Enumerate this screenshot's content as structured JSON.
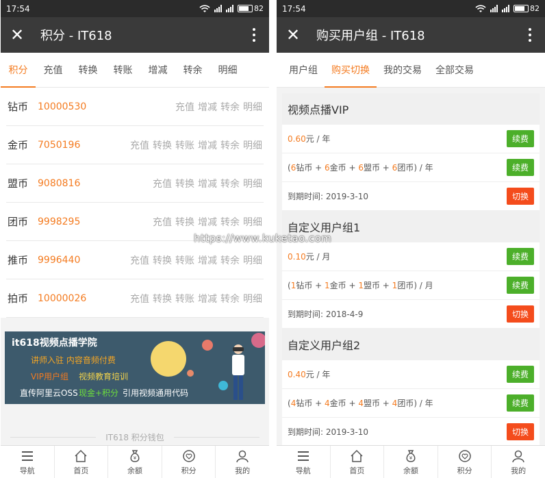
{
  "status": {
    "time": "17:54",
    "battery": "82"
  },
  "left": {
    "title": "积分 - IT618",
    "tabs": [
      "积分",
      "充值",
      "转换",
      "转账",
      "增减",
      "转余",
      "明细"
    ],
    "wallets": [
      {
        "name": "钻币",
        "value": "10000530",
        "actions": [
          "充值",
          "增减",
          "转余",
          "明细"
        ]
      },
      {
        "name": "金币",
        "value": "7050196",
        "actions": [
          "充值",
          "转换",
          "转账",
          "增减",
          "转余",
          "明细"
        ]
      },
      {
        "name": "盟币",
        "value": "9080816",
        "actions": [
          "充值",
          "转换",
          "增减",
          "转余",
          "明细"
        ]
      },
      {
        "name": "团币",
        "value": "9998295",
        "actions": [
          "充值",
          "转换",
          "增减",
          "转余",
          "明细"
        ]
      },
      {
        "name": "推币",
        "value": "9996440",
        "actions": [
          "充值",
          "转换",
          "转账",
          "增减",
          "转余",
          "明细"
        ]
      },
      {
        "name": "拍币",
        "value": "10000026",
        "actions": [
          "充值",
          "转换",
          "转账",
          "增减",
          "转余",
          "明细"
        ]
      }
    ],
    "banner": {
      "title": "it618视频点播学院",
      "line1": "讲师入驻  内容音频付费",
      "line2a": "VIP用户组",
      "line2b": "视频教育培训",
      "line3a": "直传阿里云OSS",
      "line3b": "现金+积分",
      "line3c": "引用视频通用代码"
    },
    "footer": "IT618 积分钱包"
  },
  "right": {
    "title": "购买用户组 - IT618",
    "tabs": [
      "用户组",
      "购买切换",
      "我的交易",
      "全部交易"
    ],
    "groups": [
      {
        "name": "视频点播VIP",
        "price_num": "0.60",
        "price_unit": "元 / 年",
        "combo": {
          "n1": "6",
          "n2": "6",
          "n3": "6",
          "n4": "6",
          "unit": "年"
        },
        "expire": "到期时间: 2019-3-10"
      },
      {
        "name": "自定义用户组1",
        "price_num": "0.10",
        "price_unit": "元 / 月",
        "combo": {
          "n1": "1",
          "n2": "1",
          "n3": "1",
          "n4": "1",
          "unit": "月"
        },
        "expire": "到期时间: 2018-4-9"
      },
      {
        "name": "自定义用户组2",
        "price_num": "0.40",
        "price_unit": "元 / 年",
        "combo": {
          "n1": "4",
          "n2": "4",
          "n3": "4",
          "n4": "4",
          "unit": "年"
        },
        "expire": "到期时间: 2019-3-10"
      }
    ],
    "labels": {
      "renew": "续费",
      "switch": "切换"
    }
  },
  "nav": [
    {
      "label": "导航",
      "icon": "menu-icon"
    },
    {
      "label": "首页",
      "icon": "home-icon"
    },
    {
      "label": "余额",
      "icon": "money-bag-icon"
    },
    {
      "label": "积分",
      "icon": "points-heart-icon"
    },
    {
      "label": "我的",
      "icon": "user-icon"
    }
  ],
  "watermark": "https://www.kuketao.com",
  "colors": {
    "accent": "#f47b20",
    "renew": "#4caf2a",
    "switch": "#f44c1c",
    "appbar": "#3a3a3a"
  }
}
